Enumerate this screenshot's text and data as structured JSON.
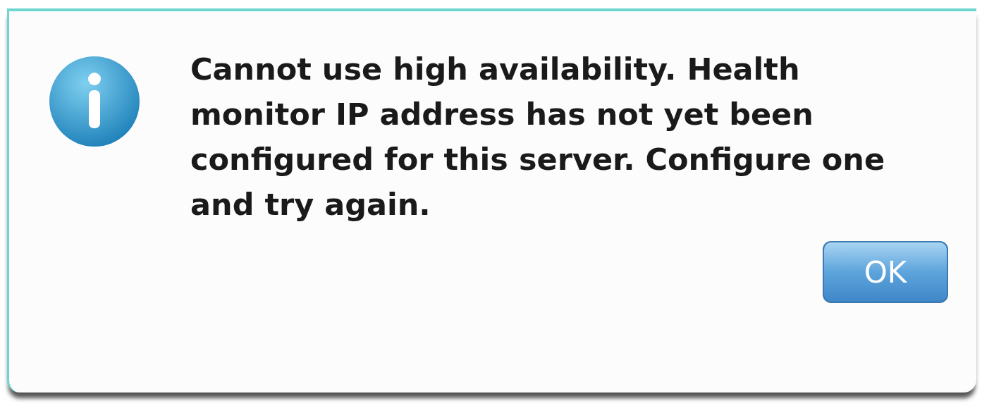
{
  "dialog": {
    "message": "Cannot use high availability. Health monitor IP address has not yet been configured for this server. Configure one and try again.",
    "buttons": [
      "OK"
    ]
  }
}
